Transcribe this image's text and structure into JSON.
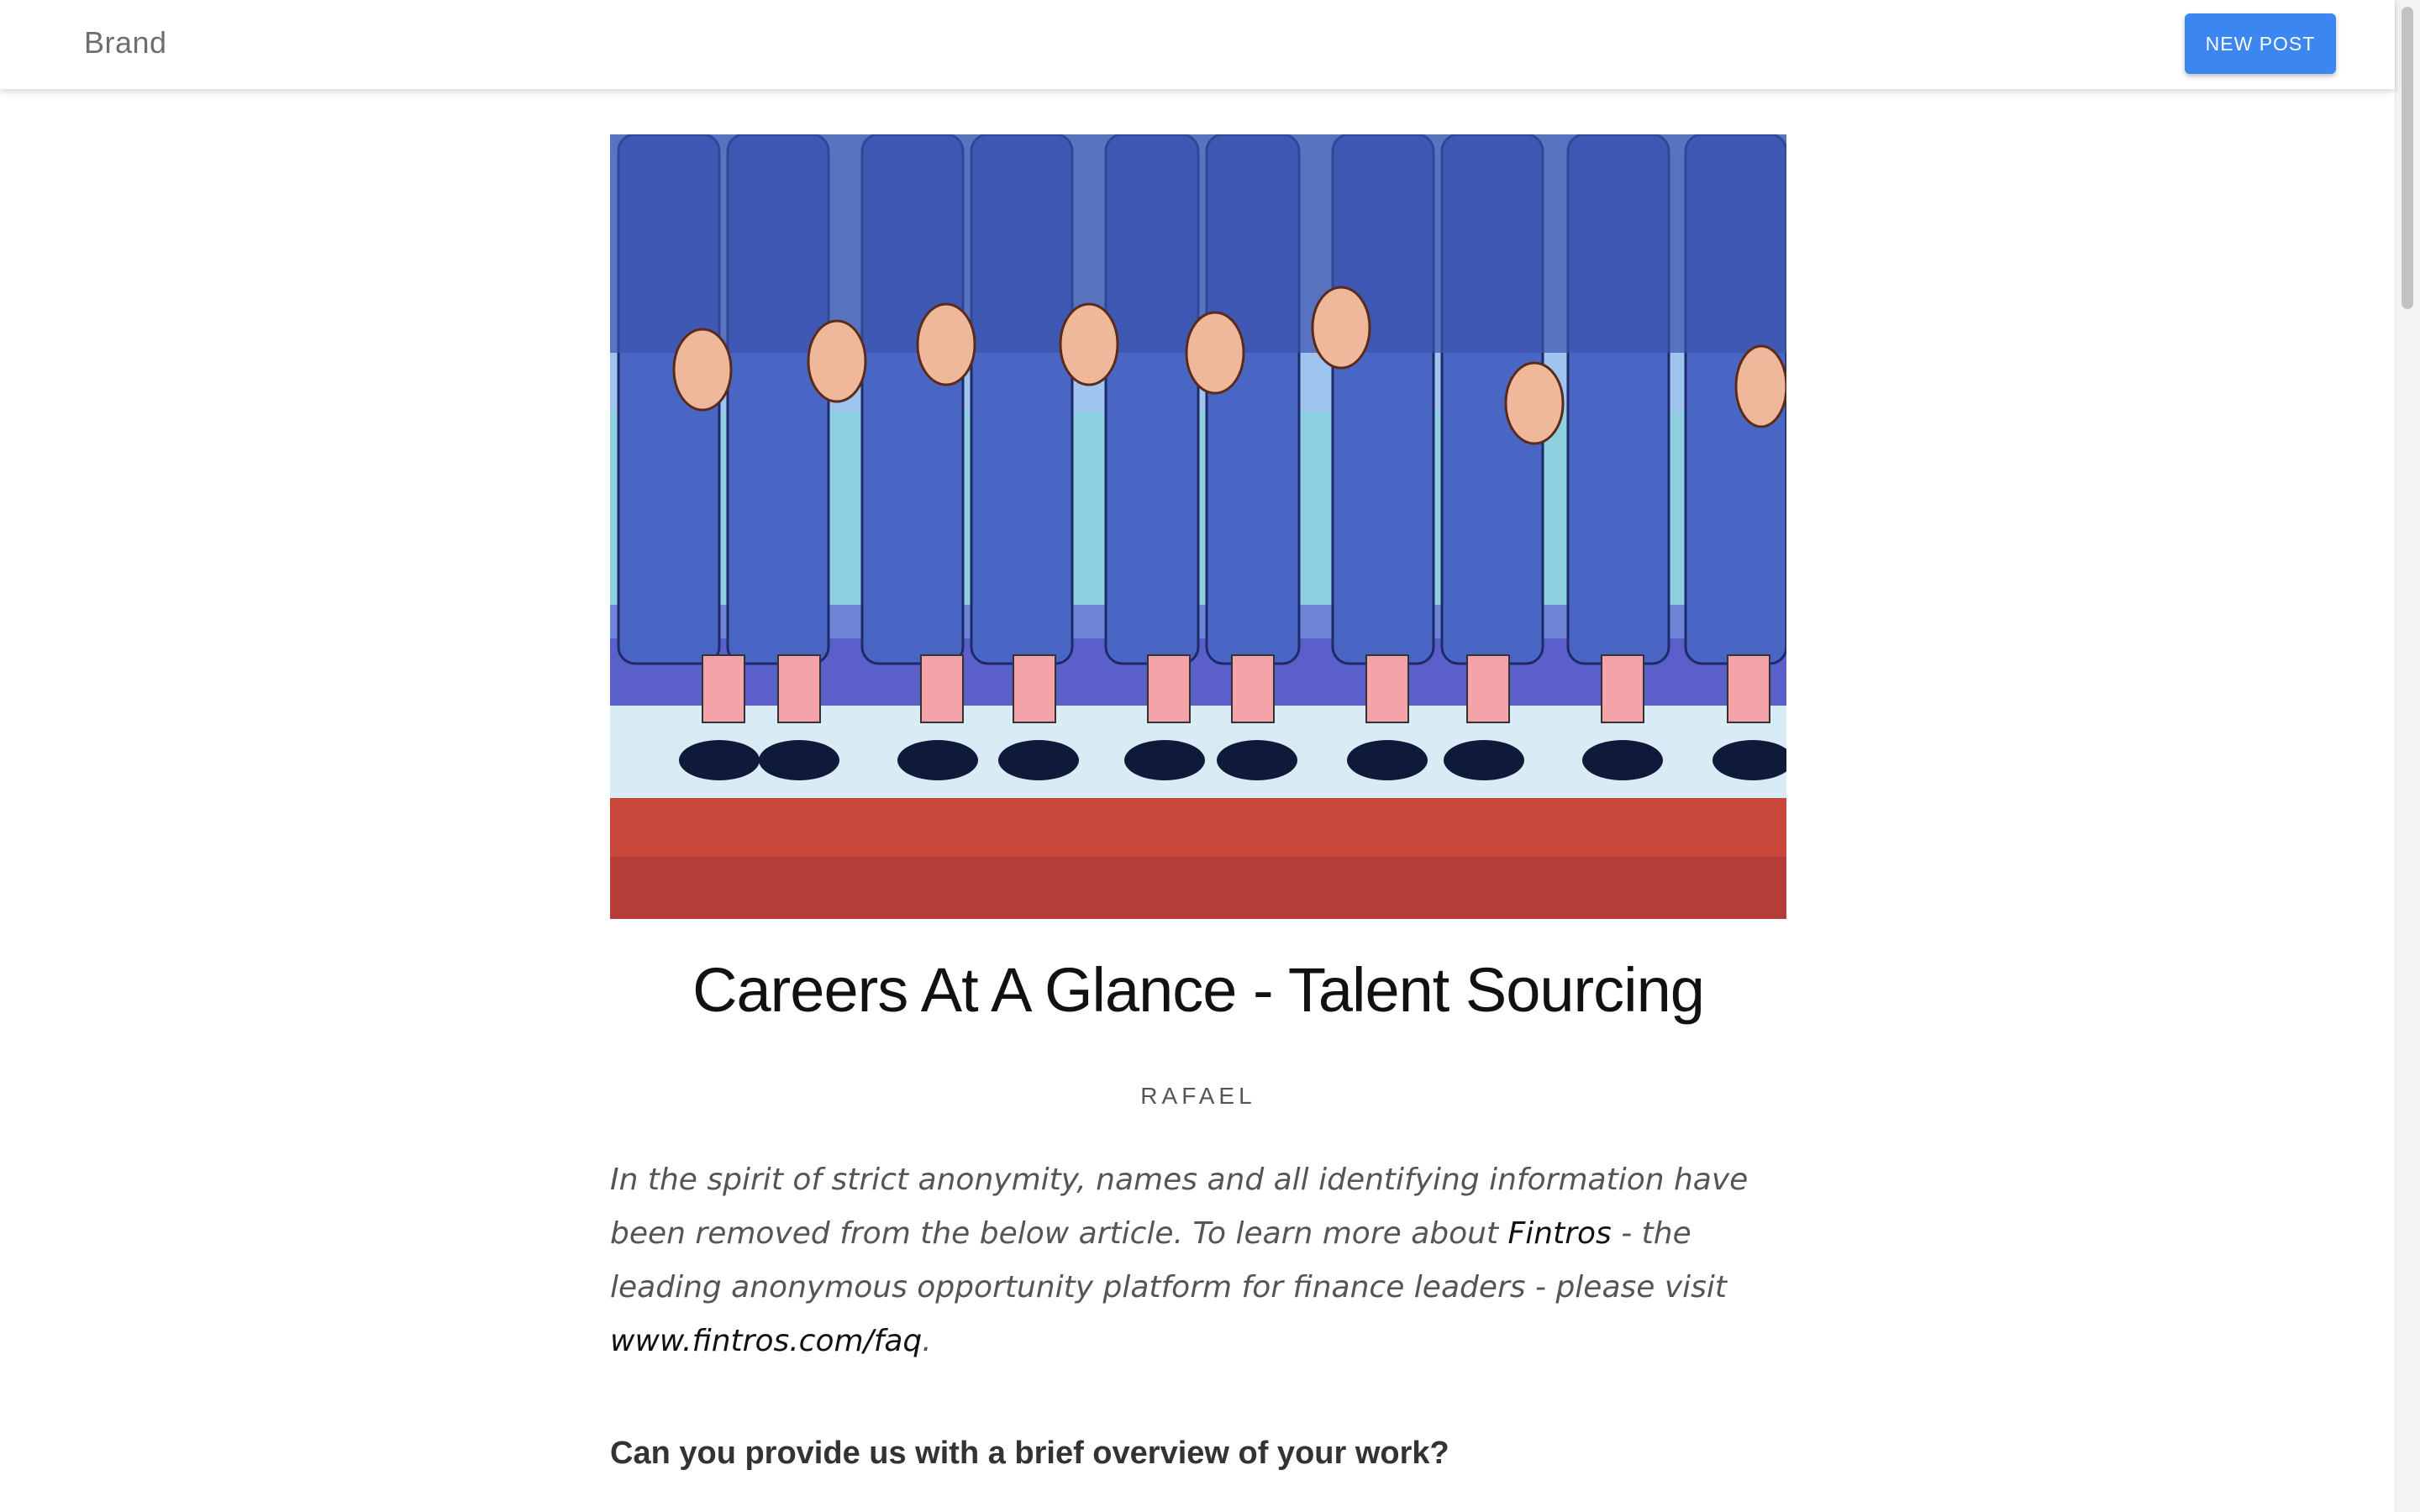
{
  "nav": {
    "brand": "Brand",
    "new_post_label": "NEW POST"
  },
  "colors": {
    "accent": "#3b86f0",
    "suit_blue": "#4a66c4",
    "floor_red": "#c9463a"
  },
  "article": {
    "title": "Careers At A Glance - Talent Sourcing",
    "author": "RAFAEL",
    "intro_part1": "In the spirit of strict anonymity, names and all identifying information have been removed from the below article. To learn more about ",
    "intro_link1": "Fintros",
    "intro_part2": " - the leading anonymous opportunity platform for finance leaders - please visit ",
    "intro_link2": "www.fintros.com/faq",
    "intro_part3": ".",
    "question1": "Can you provide us with a brief overview of your work?"
  }
}
